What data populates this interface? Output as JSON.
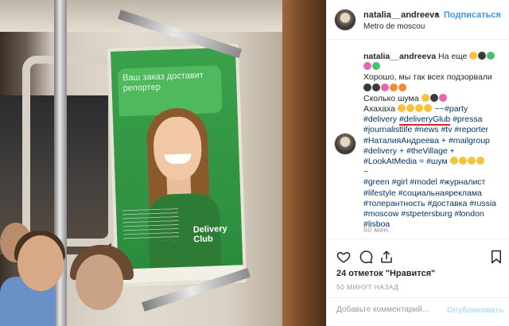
{
  "post": {
    "username": "natalia__andreeva",
    "follow_label": "Подписаться",
    "location": "Metro de moscou",
    "caption_lines": [
      "На еще",
      "Хорошо, мы так всех подзорвали",
      "Сколько шума",
      "Ахахаха",
      "~~#party",
      "#delivery",
      "#deliveryGlub",
      "#pressa",
      "#journalistlife #news #tv #reporter",
      "#НаталияАндреева + #mailgroup",
      "#delivery + #theVillage +",
      "#LookAtMedia = #шум",
      "~",
      "#green #girl #model #журналист",
      "#lifestyle #социальнаяреклама",
      "#толерантность #доставка #russia",
      "#moscow #stpetersburg #london",
      "#lisboa"
    ],
    "caption_time": "50 мин.",
    "likes": "24 отметок \"Нравится\"",
    "posted_ago": "50 МИНУТ НАЗАД",
    "comment_placeholder": "Добавьте комментарий...",
    "publish_label": "Опубликовать"
  },
  "poster": {
    "headline": "Ваш заказ доставит репортер",
    "logo_line1": "Delivery",
    "logo_line2": "Club"
  },
  "icons": [
    "heart-icon",
    "comment-icon",
    "share-icon",
    "bookmark-icon"
  ],
  "colors": {
    "link": "#3897f0",
    "hashtag": "#003569",
    "poster_green": "#2f9141",
    "underline": "#d8262f"
  }
}
